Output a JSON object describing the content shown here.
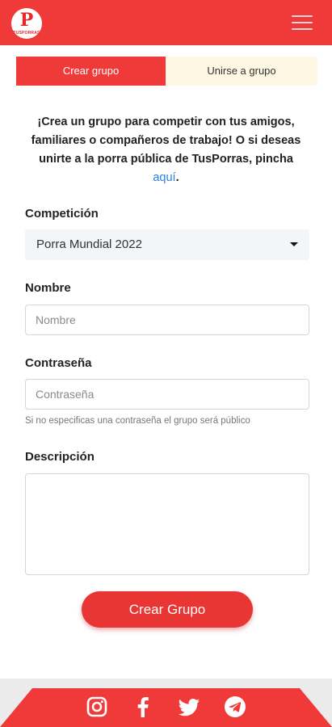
{
  "header": {
    "logo_letter": "P",
    "logo_text": "TUSPORRAS",
    "menu_icon": "hamburger-menu-icon",
    "brand_color": "#f03a3a"
  },
  "tabs": [
    {
      "label": "Crear grupo",
      "active": true
    },
    {
      "label": "Unirse a grupo",
      "active": false
    }
  ],
  "intro": {
    "text": "¡Crea un grupo para competir con tus amigos, familiares o compañeros de trabajo! O si deseas unirte a la porra pública de TusPorras, pincha ",
    "link": "aquí",
    "end": "."
  },
  "form": {
    "competition_label": "Competición",
    "competition_value": "Porra Mundial 2022",
    "name_label": "Nombre",
    "name_placeholder": "Nombre",
    "password_label": "Contraseña",
    "password_placeholder": "Contraseña",
    "password_help": "Si no especificas una contraseña el grupo será público",
    "description_label": "Descripción",
    "submit_label": "Crear Grupo"
  },
  "footer": {
    "social_icons": [
      "instagram-icon",
      "facebook-icon",
      "twitter-icon",
      "telegram-icon"
    ]
  }
}
